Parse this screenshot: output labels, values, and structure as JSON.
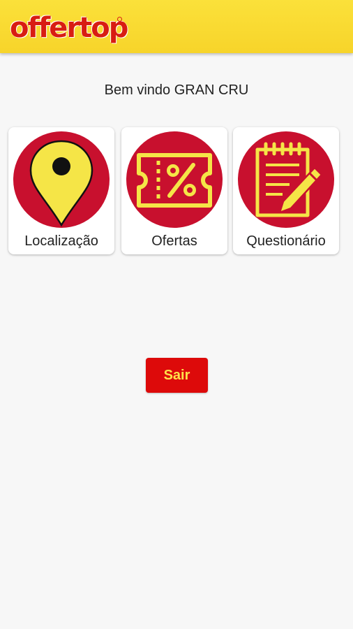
{
  "app": {
    "logo_text": "offertop",
    "brand_color": "#d81d12",
    "header_color": "#f9d930"
  },
  "welcome_text": "Bem vindo GRAN CRU",
  "menu": [
    {
      "label": "Localização",
      "icon": "map-pin-icon"
    },
    {
      "label": "Ofertas",
      "icon": "discount-ticket-icon"
    },
    {
      "label": "Questionário",
      "icon": "notepad-pencil-icon"
    }
  ],
  "exit_label": "Sair"
}
